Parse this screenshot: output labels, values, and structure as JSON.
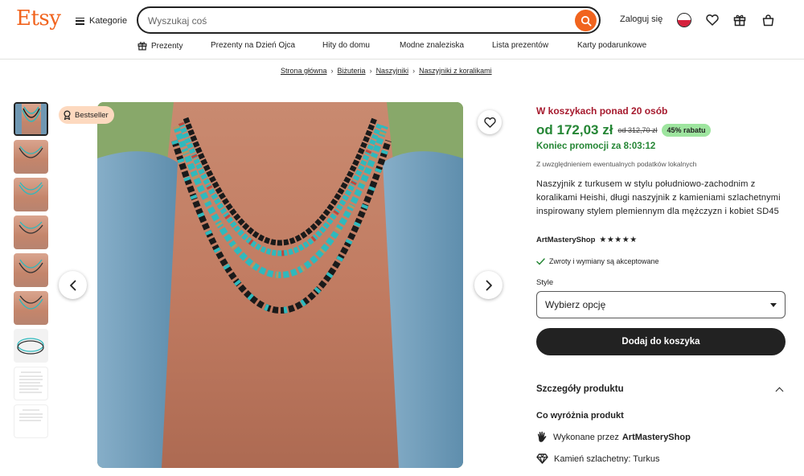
{
  "header": {
    "logo": "Etsy",
    "categories_label": "Kategorie",
    "search_placeholder": "Wyszukaj coś",
    "signin_label": "Zaloguj się"
  },
  "nav": {
    "items": [
      "Prezenty",
      "Prezenty na Dzień Ojca",
      "Hity do domu",
      "Modne znaleziska",
      "Lista prezentów",
      "Karty podarunkowe"
    ]
  },
  "breadcrumb": [
    "Strona główna",
    "Biżuteria",
    "Naszyjniki",
    "Naszyjniki z koralikami"
  ],
  "gallery": {
    "badge": "Bestseller",
    "thumbnail_count": 9
  },
  "product": {
    "basket_notice": "W koszykach ponad 20 osób",
    "price": "od 172,03 zł",
    "old_price": "od 312,70 zł",
    "discount": "45% rabatu",
    "promo_end": "Koniec promocji za 8:03:12",
    "tax_note": "Z uwzględnieniem ewentualnych podatków lokalnych",
    "title": "Naszyjnik z turkusem w stylu południowo-zachodnim z koralikami Heishi, długi naszyjnik z kamieniami szlachetnymi inspirowany stylem plemiennym dla mężczyzn i kobiet SD45",
    "shop_name": "ArtMasteryShop",
    "stars": "★★★★★",
    "rating": 5,
    "returns": "Zwroty i wymiany są akceptowane",
    "style_label": "Style",
    "style_select": "Wybierz opcję",
    "add_to_cart": "Dodaj do koszyka",
    "details_heading": "Szczegóły produktu",
    "highlights_heading": "Co wyróżnia produkt",
    "made_by_prefix": "Wykonane przez",
    "made_by_shop": "ArtMasteryShop",
    "gemstone": "Kamień szlachetny: Turkus"
  },
  "colors": {
    "brand": "#f1641e",
    "price_green": "#258635",
    "basket_red": "#a61a2e",
    "badge_bg": "#fdd9bf",
    "discount_bg": "#9ee59f"
  }
}
